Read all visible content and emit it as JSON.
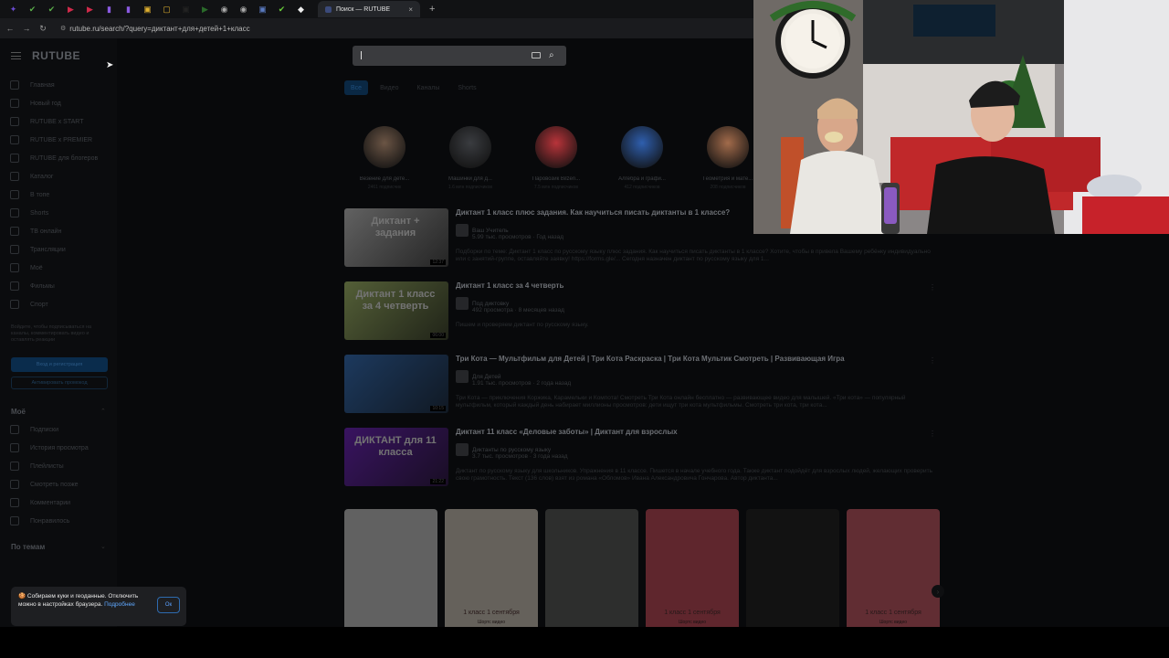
{
  "browser": {
    "tab_favicons": [
      "✦",
      "✔",
      "✔",
      "▶",
      "▶",
      "▮",
      "▮",
      "▣",
      "▢",
      "▣",
      "▶",
      "◉",
      "◉",
      "▣",
      "✔",
      "◆"
    ],
    "active_tab_title": "Поиск — RUTUBE",
    "tab_close": "×",
    "new_tab": "+",
    "nav": {
      "back": "←",
      "forward": "→",
      "reload": "↻"
    },
    "url": "rutube.ru/search/?query=диктант+для+детей+1+класс"
  },
  "site": {
    "logo": "RUTUBE",
    "cursor": "➤",
    "sidebar": {
      "items": [
        {
          "label": "Главная",
          "icon": "home-icon"
        },
        {
          "label": "Новый год",
          "icon": "tree-icon"
        },
        {
          "label": "RUTUBE x START",
          "icon": "start-icon"
        },
        {
          "label": "RUTUBE x PREMIER",
          "icon": "premier-icon"
        },
        {
          "label": "RUTUBE для блогеров",
          "icon": "blogger-icon"
        },
        {
          "label": "Каталог",
          "icon": "catalog-icon"
        },
        {
          "label": "В топе",
          "icon": "trending-icon"
        },
        {
          "label": "Shorts",
          "icon": "shorts-icon"
        },
        {
          "label": "ТВ онлайн",
          "icon": "tv-icon"
        },
        {
          "label": "Трансляции",
          "icon": "broadcast-icon"
        },
        {
          "label": "Моё",
          "icon": "my-icon"
        },
        {
          "label": "Фильмы",
          "icon": "film-icon"
        },
        {
          "label": "Спорт",
          "icon": "sport-icon"
        }
      ],
      "note": "Войдите, чтобы подписываться на каналы, комментировать видео и оставлять реакции",
      "login_button": "Вход и регистрация",
      "vk_button": "Активировать промокод",
      "my_header": "Моё",
      "my_items": [
        {
          "label": "Подписки",
          "icon": "subscriptions-icon"
        },
        {
          "label": "История просмотра",
          "icon": "history-icon"
        },
        {
          "label": "Плейлисты",
          "icon": "playlist-icon"
        },
        {
          "label": "Смотреть позже",
          "icon": "watch-later-icon"
        },
        {
          "label": "Комментарии",
          "icon": "comments-icon"
        },
        {
          "label": "Понравилось",
          "icon": "like-icon"
        }
      ],
      "topics_header": "По темам",
      "chevron": "⌃",
      "chevron2": "⌄"
    },
    "search": {
      "value": ""
    },
    "filters": [
      "Все",
      "Видео",
      "Каналы",
      "Shorts"
    ],
    "channels": [
      {
        "name": "Везение для дете...",
        "subs": "2461 подписчик",
        "color": "#6b5545"
      },
      {
        "name": "Машинки для д...",
        "subs": "1.6 млн подписчиков",
        "color": "#3a3c40"
      },
      {
        "name": "Паровозик Bilzen...",
        "subs": "7.5 млн подписчиков",
        "color": "#b8343a"
      },
      {
        "name": "Алгебра и графи...",
        "subs": "412 подписчиков",
        "color": "#2f5fae"
      },
      {
        "name": "Геометрия и мате...",
        "subs": "208 подписчиков",
        "color": "#a26b4b"
      }
    ],
    "videos": [
      {
        "title": "Диктант 1 класс плюс задания. Как научиться писать диктанты в 1 классе?",
        "channel": "Ваш Учитель",
        "meta": "5.99 тыс. просмотров · Год назад",
        "desc": "Подборки по теме: Диктант 1 класс по русскому языку плюс задания. Как научиться писать диктанты в 1 классе? Хотите, чтобы в привела Вашему ребёнку индивидуально или с занятий-группе, оставляйте заявку! https://forms.gle/... Сегодня назначен диктант по русскому языку для 1...",
        "thumb_text": "Диктант + задания",
        "thumb_bg": "#d8d8d8",
        "duration": "12:37"
      },
      {
        "title": "Диктант 1 класс за 4 четверть",
        "channel": "Под диктовку",
        "meta": "492 просмотра · 8 месяцев назад",
        "desc": "Пишем и проверяем диктант по русскому языку.",
        "thumb_text": "Диктант 1 класс за 4 четверть",
        "thumb_bg": "#b9d27a",
        "duration": "06:00"
      },
      {
        "title": "Три Кота — Мультфильм для Детей | Три Кота Раскраска | Три Кота Мультик Смотреть | Развивающая Игра",
        "channel": "Для Детей",
        "meta": "1.91 тыс. просмотров · 2 года назад",
        "desc": "Три Кота — приключения Коржика, Карамельки и Компота! Смотреть Три Кота онлайн бесплатно — развивающее видео для малышей. «Три кота» — популярный мультфильм, который каждый день набирает миллионы просмотров: дети ищут три кота мультфильмы. Смотреть три кота, три кота...",
        "thumb_text": "",
        "thumb_bg": "#3f7fd0",
        "duration": "10:15"
      },
      {
        "title": "Диктант 11 класс «Деловые заботы» | Диктант для взрослых",
        "channel": "Диктанты по русскому языку",
        "meta": "3.7 тыс. просмотров · 3 года назад",
        "desc": "Диктант по русскому языку для школьников. Упражнения в 11 классе. Пишется в начале учебного года. Также диктант подойдёт для взрослых людей, желающих проверить свою грамотность. Текст (136 слов) взят из романа «Обломов» Ивана Александровича Гончарова. Автор диктанта...",
        "thumb_text": "ДИКТАНТ для 11 класса",
        "thumb_bg": "#7e2bd6",
        "duration": "21:22"
      }
    ],
    "shorts": [
      {
        "title": "",
        "sub": "",
        "bg": "#e8e8e8"
      },
      {
        "title": "1 класс 1 сентября",
        "sub": "Шортс видео",
        "bg": "#f0e6d8"
      },
      {
        "title": "",
        "sub": "",
        "bg": "#6a6d6a"
      },
      {
        "title": "1 класс 1 сентября",
        "sub": "Шортс видео",
        "bg": "#e25a6a"
      },
      {
        "title": "",
        "sub": "",
        "bg": "#2a2a2a"
      },
      {
        "title": "1 класс 1 сентября",
        "sub": "Шортс видео",
        "bg": "#e86a7a"
      }
    ],
    "shorts_arrow": "›",
    "cookie": {
      "text": "🍪 Собираем куки и геоданные. Отключить можно в настройках браузера.",
      "more": "Подробнее",
      "ok": "Ок"
    },
    "kebab": "⋮"
  }
}
